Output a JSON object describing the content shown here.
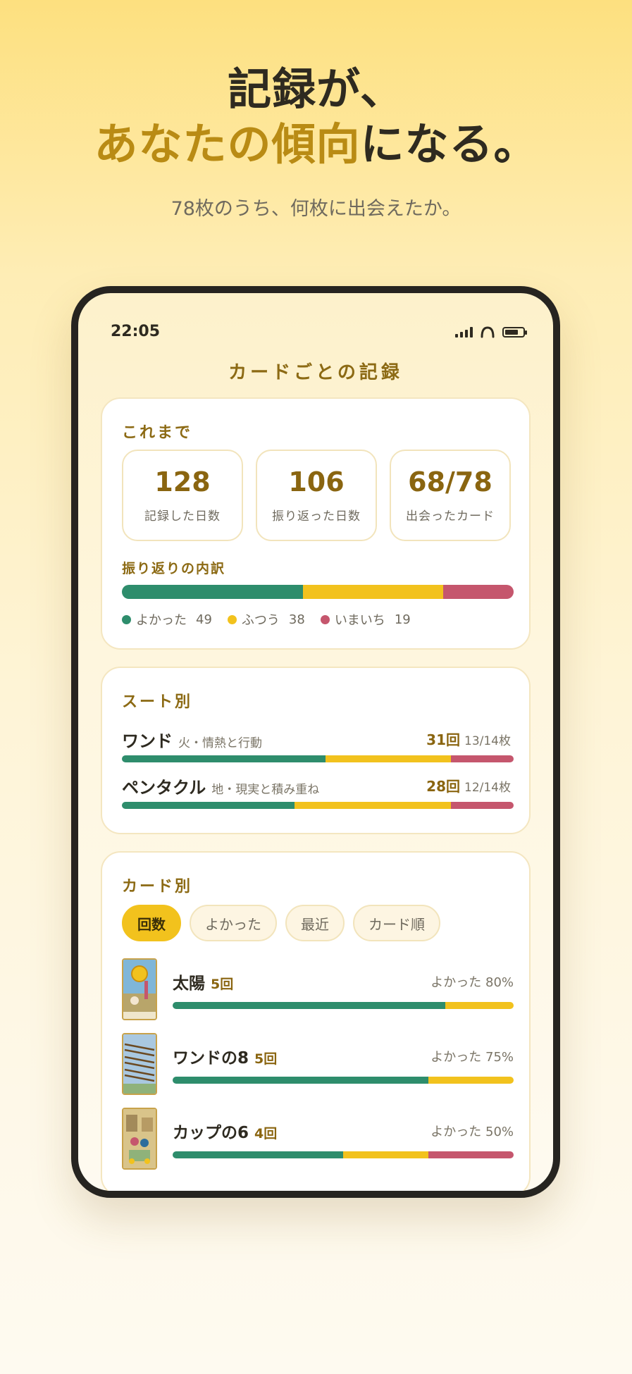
{
  "hero": {
    "line1": "記録が、",
    "line2_accent": "あなたの傾向",
    "line2_rest": "になる。",
    "subtitle": "78枚のうち、何枚に出会えたか。"
  },
  "status_bar": {
    "time": "22:05",
    "battery_level": 0.75
  },
  "screen_title": "カードごとの記録",
  "summary": {
    "title": "これまで",
    "stats": [
      {
        "value": "128",
        "label": "記録した日数"
      },
      {
        "value": "106",
        "label": "振り返った日数"
      },
      {
        "value": "68/78",
        "label": "出会ったカード"
      }
    ],
    "breakdown_title": "振り返りの内訳",
    "breakdown": [
      {
        "label": "よかった",
        "value": 49,
        "color": "#2e8d6c"
      },
      {
        "label": "ふつう",
        "value": 38,
        "color": "#f2c21d"
      },
      {
        "label": "いまいち",
        "value": 19,
        "color": "#c5566d"
      }
    ]
  },
  "suits": {
    "title": "スート別",
    "items": [
      {
        "name": "ワンド",
        "desc": "火・情熱と行動",
        "count": "31回",
        "met": "13/14枚",
        "ratio": [
          0.52,
          0.32,
          0.16
        ]
      },
      {
        "name": "ペンタクル",
        "desc": "地・現実と積み重ね",
        "count": "28回",
        "met": "12/14枚",
        "ratio": [
          0.44,
          0.4,
          0.16
        ]
      }
    ]
  },
  "cards": {
    "title": "カード別",
    "tabs": [
      "回数",
      "よかった",
      "最近",
      "カード順"
    ],
    "active_tab": 0,
    "items": [
      {
        "name": "太陽",
        "count": "5回",
        "pct_label": "よかった 80%",
        "ratio": [
          0.8,
          0.2,
          0.0
        ],
        "thumb_icon": "sun-card-icon"
      },
      {
        "name": "ワンドの8",
        "count": "5回",
        "pct_label": "よかった 75%",
        "ratio": [
          0.75,
          0.25,
          0.0
        ],
        "thumb_icon": "eight-of-wands-card-icon"
      },
      {
        "name": "カップの6",
        "count": "4回",
        "pct_label": "よかった 50%",
        "ratio": [
          0.5,
          0.25,
          0.25
        ],
        "thumb_icon": "six-of-cups-card-icon"
      }
    ]
  },
  "colors": {
    "good": "#2e8d6c",
    "normal": "#f2c21d",
    "bad": "#c5566d",
    "accent": "#b98b14"
  }
}
